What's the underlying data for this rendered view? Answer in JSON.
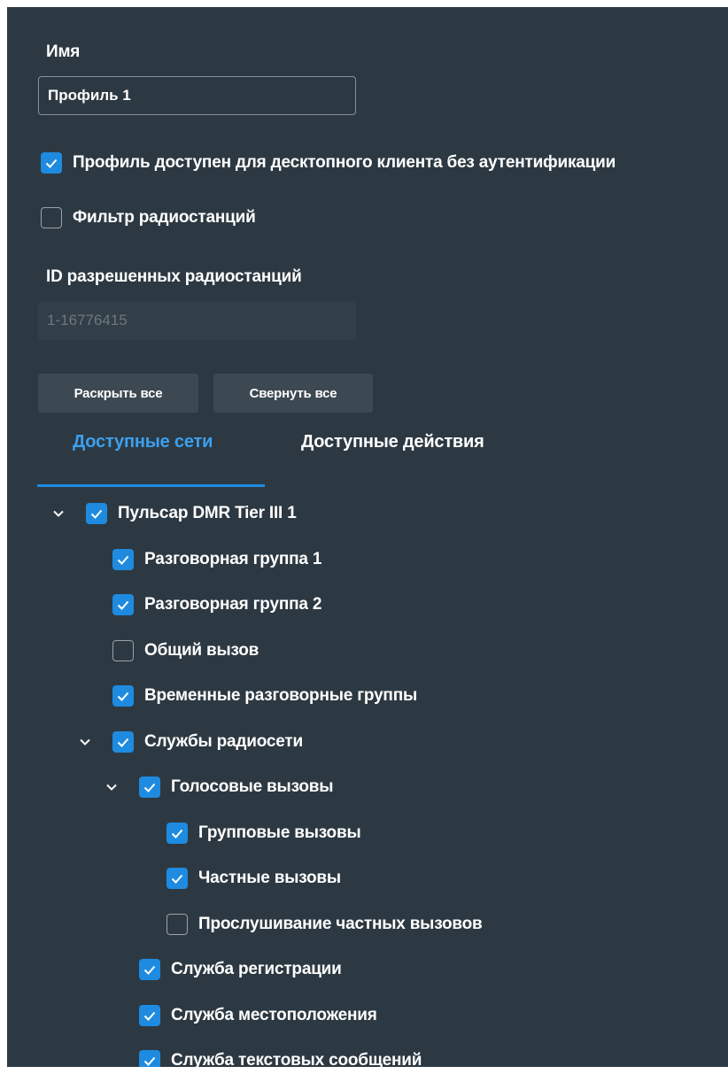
{
  "form": {
    "name_label": "Имя",
    "name_value": "Профиль 1",
    "desktop_access_label": "Профиль доступен для десктопного клиента без аутентификации",
    "desktop_access_checked": true,
    "radio_filter_label": "Фильтр радиостанций",
    "radio_filter_checked": false,
    "allowed_ids_label": "ID разрешенных радиостанций",
    "allowed_ids_placeholder": "1-16776415"
  },
  "buttons": {
    "expand_all": "Раскрыть все",
    "collapse_all": "Свернуть все"
  },
  "tabs": [
    {
      "label": "Доступные сети",
      "active": true
    },
    {
      "label": "Доступные действия",
      "active": false
    }
  ],
  "tree": [
    {
      "label": "Пульсар DMR Tier III 1",
      "checked": true,
      "expanded": true,
      "level": 0
    },
    {
      "label": "Разговорная группа 1",
      "checked": true,
      "level": 1
    },
    {
      "label": "Разговорная группа 2",
      "checked": true,
      "level": 1
    },
    {
      "label": "Общий вызов",
      "checked": false,
      "level": 1
    },
    {
      "label": "Временные разговорные группы",
      "checked": true,
      "level": 1
    },
    {
      "label": "Службы радиосети",
      "checked": true,
      "expanded": true,
      "level": 1
    },
    {
      "label": "Голосовые вызовы",
      "checked": true,
      "expanded": true,
      "level": 2
    },
    {
      "label": "Групповые вызовы",
      "checked": true,
      "level": 3
    },
    {
      "label": "Частные вызовы",
      "checked": true,
      "level": 3
    },
    {
      "label": "Прослушивание частных вызовов",
      "checked": false,
      "level": 3
    },
    {
      "label": "Служба регистрации",
      "checked": true,
      "level": 2
    },
    {
      "label": "Служба местоположения",
      "checked": true,
      "level": 2
    },
    {
      "label": "Служба текстовых сообщений",
      "checked": true,
      "level": 2
    }
  ],
  "colors": {
    "panel_bg": "#2d3942",
    "accent": "#1e8be0",
    "tab_active_text": "#3ba0ef",
    "button_bg": "#3c4852"
  }
}
